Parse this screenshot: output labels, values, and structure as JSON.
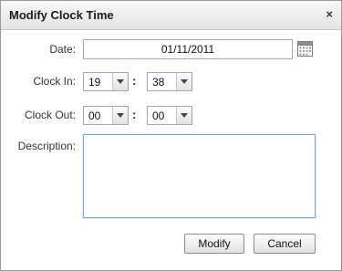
{
  "dialog": {
    "title": "Modify Clock Time",
    "close_label": "×"
  },
  "form": {
    "date_label": "Date:",
    "date_value": "01/11/2011",
    "clock_in_label": "Clock In:",
    "clock_in_hour": "19",
    "clock_in_minute": "38",
    "clock_out_label": "Clock Out:",
    "clock_out_hour": "00",
    "clock_out_minute": "00",
    "time_separator": ":",
    "description_label": "Description:",
    "description_value": ""
  },
  "buttons": {
    "modify_label": "Modify",
    "cancel_label": "Cancel"
  },
  "icons": {
    "calendar": "calendar-icon",
    "dropdown": "chevron-down-icon"
  }
}
